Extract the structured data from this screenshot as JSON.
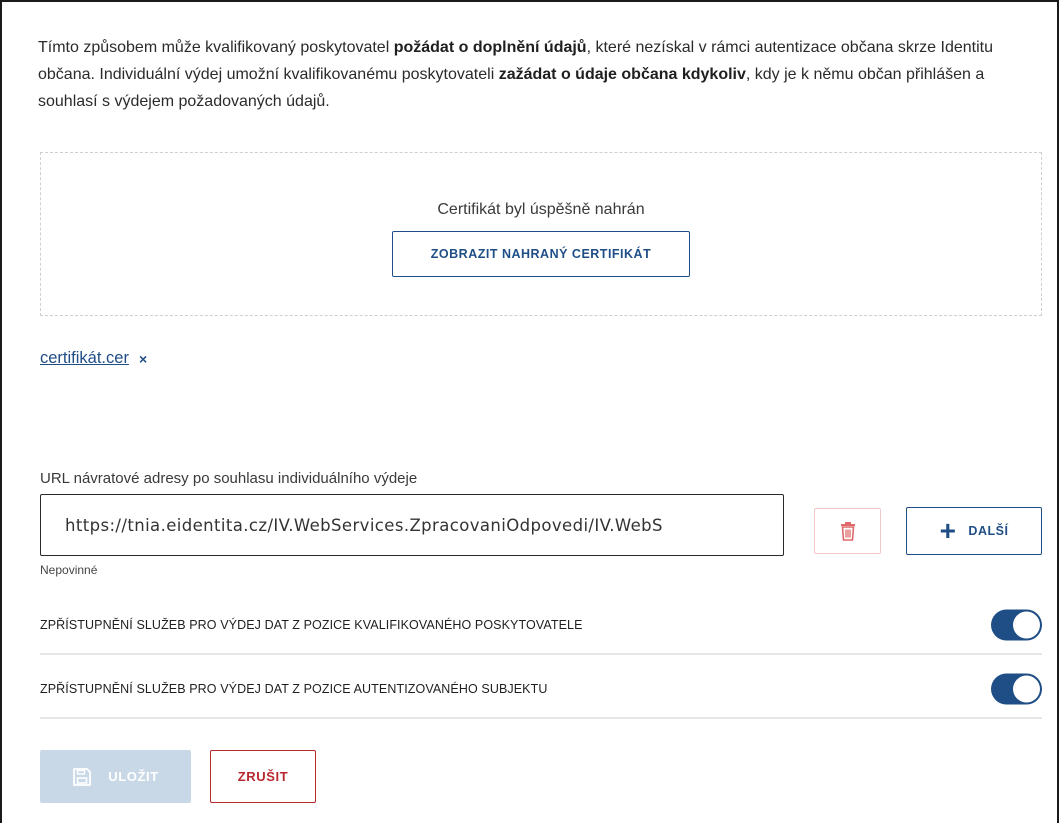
{
  "intro": {
    "p1": "Tímto způsobem může kvalifikovaný poskytovatel ",
    "b1": "požádat o doplnění údajů",
    "p2": ", které nezískal v rámci autentizace občana skrze Identitu občana. Individuální výdej umožní kvalifikovanému poskytovateli ",
    "b2": "zažádat o údaje občana kdykoliv",
    "p3": ", kdy je k němu občan přihlášen a souhlasí s výdejem požadovaných údajů."
  },
  "upload": {
    "message": "Certifikát byl úspěšně nahrán",
    "view_button": "ZOBRAZIT NAHRANÝ CERTIFIKÁT"
  },
  "file": {
    "name": "certifikát.cer",
    "remove_icon": "close-icon",
    "remove_glyph": "×"
  },
  "return_url": {
    "label": "URL návratové adresy po souhlasu individuálního výdeje",
    "value": "https://tnia.eidentita.cz/IV.WebServices.ZpracovaniOdpovedi/IV.WebS",
    "hint": "Nepovinné",
    "delete_icon": "trash-icon",
    "add_label": "DALŠÍ",
    "add_icon": "plus-icon",
    "add_glyph": "+"
  },
  "toggles": [
    {
      "label": "ZPŘÍSTUPNĚNÍ SLUŽEB PRO VÝDEJ DAT Z POZICE KVALIFIKOVANÉHO POSKYTOVATELE",
      "on": true
    },
    {
      "label": "ZPŘÍSTUPNĚNÍ SLUŽEB PRO VÝDEJ DAT Z POZICE AUTENTIZOVANÉHO SUBJEKTU",
      "on": true
    }
  ],
  "actions": {
    "save_label": "ULOŽIT",
    "save_icon": "save-icon",
    "cancel_label": "ZRUŠIT"
  },
  "colors": {
    "primary": "#1f4e86",
    "danger": "#b8292f",
    "disabled": "#c9d8e6",
    "delete_icon": "#e06a6a"
  }
}
